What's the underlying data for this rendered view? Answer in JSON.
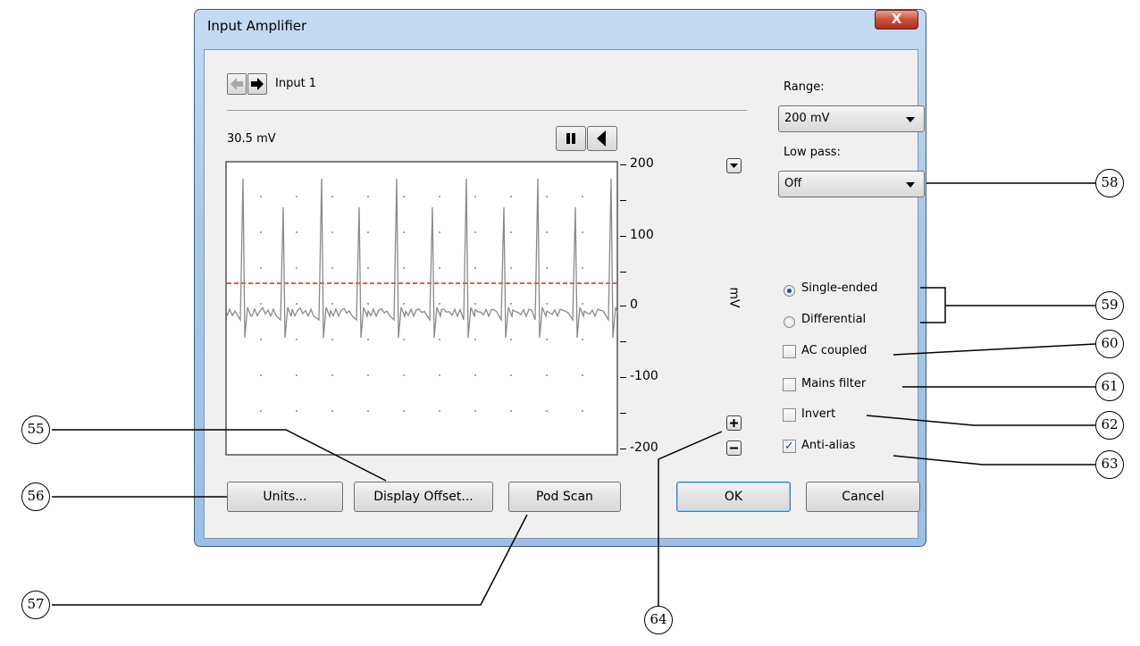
{
  "window": {
    "title": "Input Amplifier",
    "close_glyph": "X"
  },
  "channel": {
    "name": "Input 1",
    "prev_icon": "arrow-left-icon",
    "next_icon": "arrow-right-icon"
  },
  "reading": "30.5 mV",
  "axis": {
    "ticks": [
      "200",
      "100",
      "0",
      "-100",
      "-200"
    ],
    "unit": "mV"
  },
  "range": {
    "label": "Range:",
    "value": "200 mV"
  },
  "lowpass": {
    "label": "Low pass:",
    "value": "Off"
  },
  "mode": {
    "single_label": "Single-ended",
    "diff_label": "Differential",
    "selected": "Single-ended"
  },
  "options": [
    {
      "label": "AC coupled",
      "checked": false
    },
    {
      "label": "Mains filter",
      "checked": false
    },
    {
      "label": "Invert",
      "checked": false
    },
    {
      "label": "Anti-alias",
      "checked": true
    }
  ],
  "buttons": {
    "units": "Units...",
    "offset": "Display Offset...",
    "podscan": "Pod Scan",
    "ok": "OK",
    "cancel": "Cancel"
  },
  "callouts": [
    "55",
    "56",
    "57",
    "58",
    "59",
    "60",
    "61",
    "62",
    "63",
    "64"
  ],
  "colors": {
    "threshold": "#e02020",
    "trace": "#808080",
    "accent": "#1e4f9a"
  }
}
